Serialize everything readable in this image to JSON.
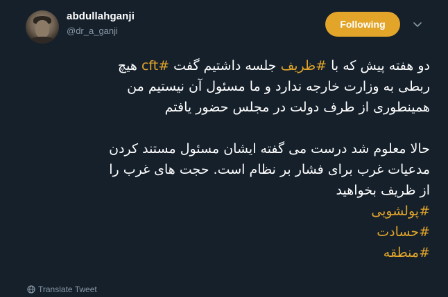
{
  "author": {
    "display_name": "abdullahganji",
    "handle": "@dr_a_ganji"
  },
  "follow_button": {
    "label": "Following"
  },
  "tweet": {
    "line1_before": "دو هفته پیش که با ",
    "line1_hashtag1": "#ظریف",
    "line1_middle": " جلسه داشتیم گفت ",
    "line1_hashtag2": "#cft",
    "line1_after": " هیچ",
    "line2": "ربطی به وزارت خارجه ندارد و ما مسئول آن نیستیم من",
    "line3": "همینطوری از طرف دولت در مجلس حضور یافتم",
    "line4": "حالا معلوم شد درست می گفته ایشان مسئول مستند کردن",
    "line5": "مدعیات غرب برای فشار بر نظام است. حجت های غرب را",
    "line6": "از ظریف بخواهید",
    "hashtags": [
      "#پولشویی",
      "#حسادت",
      "#منطقه"
    ]
  },
  "translate": {
    "label": "Translate Tweet",
    "icon": "globe-icon"
  },
  "colors": {
    "background": "#15202b",
    "accent": "#e2a52a",
    "text": "#ffffff",
    "muted": "#8899a6"
  }
}
